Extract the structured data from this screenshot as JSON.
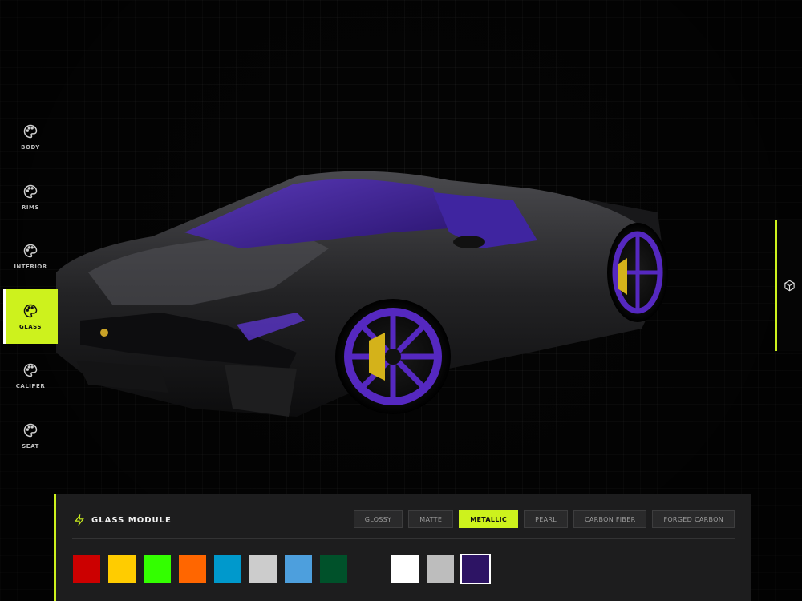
{
  "accent_color": "#cdf21d",
  "sidebar": {
    "items": [
      {
        "label": "BODY",
        "icon": "palette-icon"
      },
      {
        "label": "RIMS",
        "icon": "palette-icon"
      },
      {
        "label": "INTERIOR",
        "icon": "palette-icon"
      },
      {
        "label": "GLASS",
        "icon": "palette-icon",
        "active": true
      },
      {
        "label": "CALIPER",
        "icon": "palette-icon"
      },
      {
        "label": "SEAT",
        "icon": "palette-icon"
      }
    ]
  },
  "view_toggle": {
    "icon": "cube-icon"
  },
  "panel": {
    "title": "GLASS MODULE",
    "title_icon": "lightning-icon",
    "finishes": [
      "GLOSSY",
      "MATTE",
      "METALLIC",
      "PEARL",
      "CARBON FIBER",
      "FORGED CARBON"
    ],
    "active_finish": "METALLIC",
    "colors": [
      "#cc0000",
      "#ffcc00",
      "#33ff00",
      "#ff6600",
      "#0099cc",
      "#cccccc",
      "#4d9fdd",
      "#00512a",
      "#ffffff",
      "#bdbdbd",
      "#2d1464"
    ],
    "selected_color": "#2d1464"
  }
}
